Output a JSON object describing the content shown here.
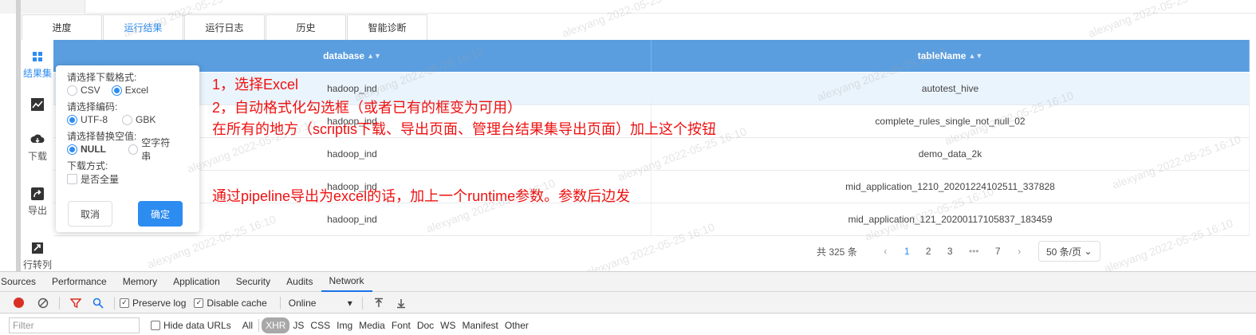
{
  "tabs": [
    {
      "label": "进度",
      "active": false
    },
    {
      "label": "运行结果",
      "active": true
    },
    {
      "label": "运行日志",
      "active": false
    },
    {
      "label": "历史",
      "active": false
    },
    {
      "label": "智能诊断",
      "active": false
    }
  ],
  "sidebar": {
    "items": [
      {
        "label": "结果集",
        "icon": "grid-icon"
      },
      {
        "label": "",
        "icon": "chart-icon"
      },
      {
        "label": "下载",
        "icon": "cloud-download-icon"
      },
      {
        "label": "导出",
        "icon": "share-icon"
      },
      {
        "label": "行转列",
        "icon": "transpose-icon"
      }
    ]
  },
  "table": {
    "columns": [
      "database",
      "tableName"
    ],
    "rows": [
      [
        "hadoop_ind",
        "autotest_hive"
      ],
      [
        "hadoop_ind",
        "complete_rules_single_not_null_02"
      ],
      [
        "hadoop_ind",
        "demo_data_2k"
      ],
      [
        "hadoop_ind",
        "mid_application_1210_20201224102511_337828"
      ],
      [
        "hadoop_ind",
        "mid_application_121_20200117105837_183459"
      ]
    ]
  },
  "pagination": {
    "total": "共 325 条",
    "prev": "‹",
    "next": "›",
    "pages": [
      "1",
      "2",
      "3",
      "•••",
      "7"
    ],
    "current": "1",
    "page_size": "50 条/页"
  },
  "download_popover": {
    "format_label": "请选择下载格式:",
    "format_options": [
      "CSV",
      "Excel"
    ],
    "format_selected": "Excel",
    "encoding_label": "请选择编码:",
    "encoding_options": [
      "UTF-8",
      "GBK"
    ],
    "encoding_selected": "UTF-8",
    "null_label": "请选择替换空值:",
    "null_options": [
      "NULL",
      "空字符串"
    ],
    "null_selected": "NULL",
    "mode_label": "下载方式:",
    "full_label": "是否全量",
    "cancel_label": "取消",
    "ok_label": "确定"
  },
  "annotations": [
    "1，选择Excel",
    "2，自动格式化勾选框（或者已有的框变为可用）",
    "在所有的地方（scriptis下载、导出页面、管理台结果集导出页面）加上这个按钮",
    "通过pipeline导出为excel的话，加上一个runtime参数。参数后边发"
  ],
  "watermark": "alexyang 2022-05-25 16:10",
  "devtools": {
    "tabs": [
      "Sources",
      "Performance",
      "Memory",
      "Application",
      "Security",
      "Audits",
      "Network"
    ],
    "active_tab": "Network",
    "preserve_log": "Preserve log",
    "disable_cache": "Disable cache",
    "throttle": "Online",
    "filter_placeholder": "Filter",
    "hide_data_urls": "Hide data URLs",
    "filter_types": [
      "All",
      "XHR",
      "JS",
      "CSS",
      "Img",
      "Media",
      "Font",
      "Doc",
      "WS",
      "Manifest",
      "Other"
    ],
    "active_filter": "XHR"
  },
  "colors": {
    "header_blue": "#5a9ee0",
    "accent": "#2d8cf0",
    "annotation_red": "#ee1111",
    "record_red": "#d93025"
  }
}
